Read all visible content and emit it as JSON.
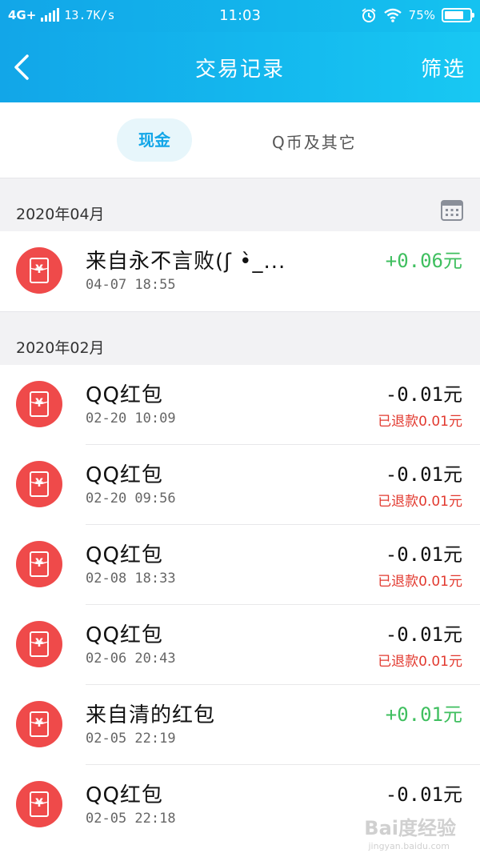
{
  "status_bar": {
    "network": "4G+",
    "speed": "13.7K/s",
    "time": "11:03",
    "battery": "75%",
    "battery_level": 0.75
  },
  "header": {
    "title": "交易记录",
    "filter_label": "筛选"
  },
  "tabs": {
    "active": "现金",
    "other": "Q币及其它"
  },
  "sections": [
    {
      "month": "2020年04月",
      "records": [
        {
          "title": "来自永不言败(ʃ •̀_...",
          "time": "04-07 18:55",
          "amount": "+0.06元",
          "type": "income",
          "refund": ""
        }
      ]
    },
    {
      "month": "2020年02月",
      "records": [
        {
          "title": "QQ红包",
          "time": "02-20 10:09",
          "amount": "-0.01元",
          "type": "expense",
          "refund": "已退款0.01元"
        },
        {
          "title": "QQ红包",
          "time": "02-20 09:56",
          "amount": "-0.01元",
          "type": "expense",
          "refund": "已退款0.01元"
        },
        {
          "title": "QQ红包",
          "time": "02-08 18:33",
          "amount": "-0.01元",
          "type": "expense",
          "refund": "已退款0.01元"
        },
        {
          "title": "QQ红包",
          "time": "02-06 20:43",
          "amount": "-0.01元",
          "type": "expense",
          "refund": "已退款0.01元"
        },
        {
          "title": "来自清的红包",
          "time": "02-05 22:19",
          "amount": "+0.01元",
          "type": "income",
          "refund": ""
        },
        {
          "title": "QQ红包",
          "time": "02-05 22:18",
          "amount": "-0.01元",
          "type": "expense",
          "refund": ""
        }
      ]
    }
  ],
  "icons": {
    "back": "back-arrow-icon",
    "calendar": "calendar-icon",
    "red_packet": "red-packet-icon"
  },
  "colors": {
    "header": "#14b8ee",
    "income": "#3fbf5f",
    "refund": "#e2392f",
    "red_packet": "#ef4a4a"
  },
  "watermark": {
    "main": "Bai度经验",
    "sub": "jingyan.baidu.com"
  }
}
